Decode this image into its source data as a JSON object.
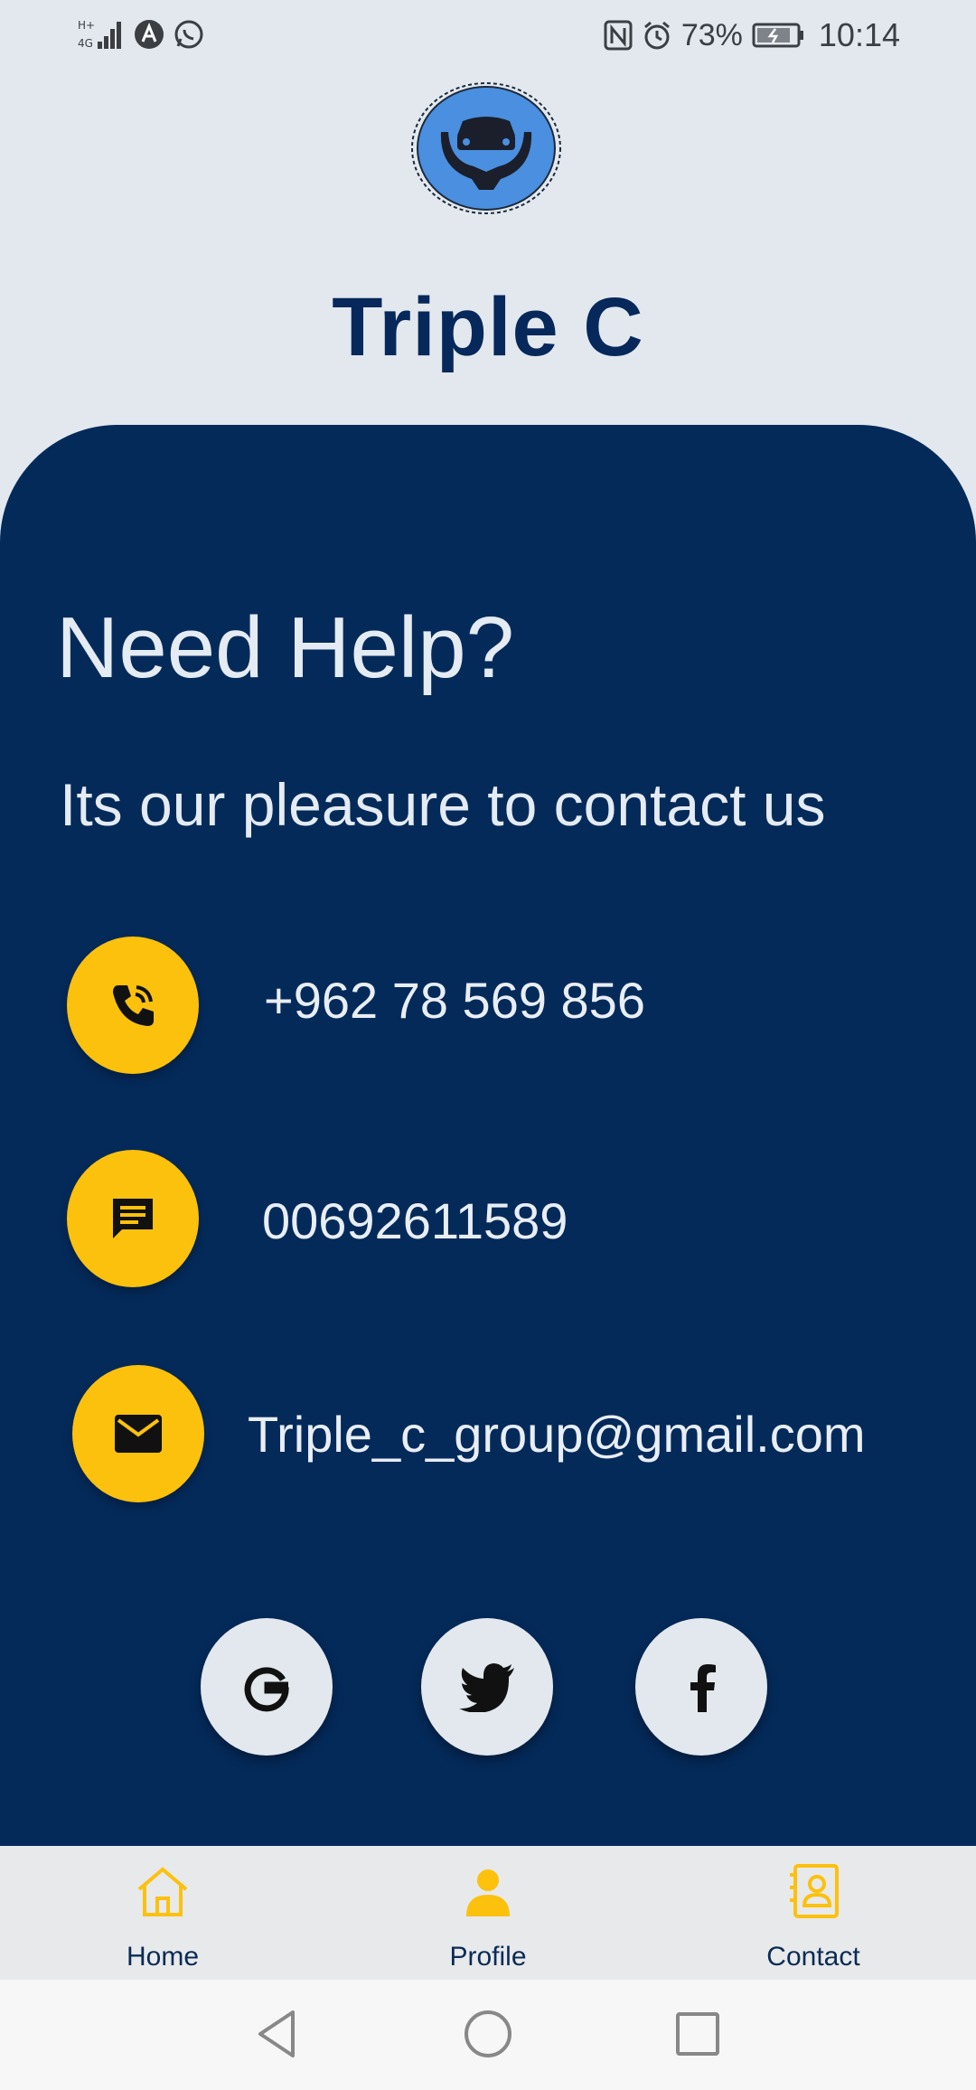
{
  "status_bar": {
    "battery_percent": "73%",
    "time": "10:14"
  },
  "app": {
    "title": "Triple C"
  },
  "help": {
    "heading": "Need Help?",
    "subtitle": "Its our pleasure to contact us"
  },
  "contacts": [
    {
      "icon": "phone-icon",
      "value": "+962 78 569 856"
    },
    {
      "icon": "message-icon",
      "value": "00692611589"
    },
    {
      "icon": "mail-icon",
      "value": "Triple_c_group@gmail.com"
    }
  ],
  "social": [
    {
      "icon": "google-icon"
    },
    {
      "icon": "twitter-icon"
    },
    {
      "icon": "facebook-icon"
    }
  ],
  "bottom_nav": {
    "items": [
      {
        "label": "Home",
        "icon": "home-icon"
      },
      {
        "label": "Profile",
        "icon": "person-icon"
      },
      {
        "label": "Contact",
        "icon": "contact-card-icon"
      }
    ]
  },
  "colors": {
    "panel": "#042a5a",
    "accent": "#fcc10c",
    "title": "#06285a",
    "background": "#e2e8ee"
  }
}
